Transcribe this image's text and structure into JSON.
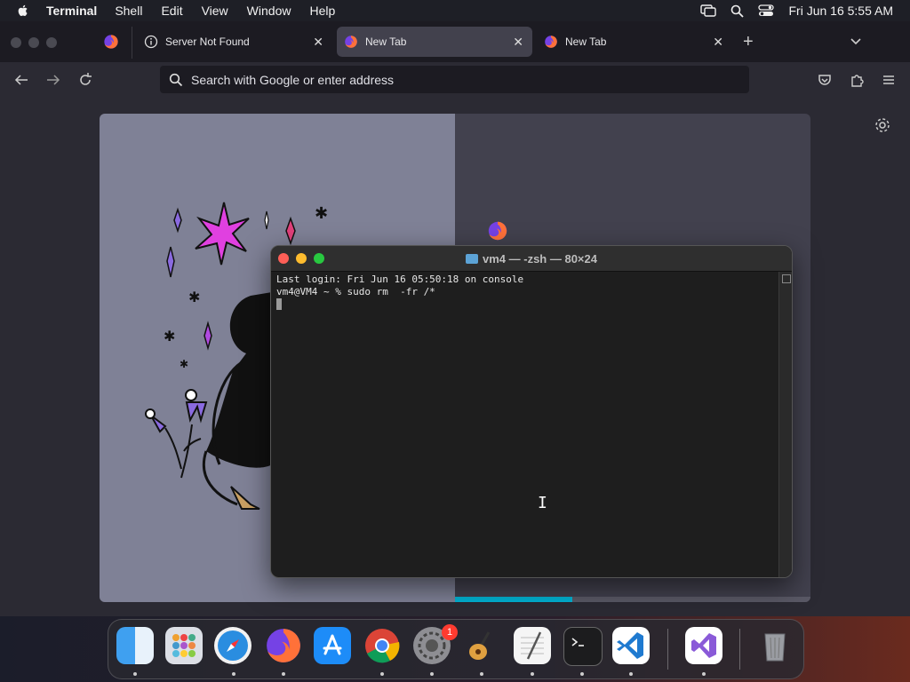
{
  "menubar": {
    "app_name": "Terminal",
    "items": [
      "Shell",
      "Edit",
      "View",
      "Window",
      "Help"
    ],
    "clock": "Fri Jun 16  5:55 AM",
    "icons": [
      "apple-icon",
      "screen-mirroring-icon",
      "spotlight-search-icon",
      "control-center-icon"
    ]
  },
  "browser": {
    "tabs": [
      {
        "label": "Server Not Found",
        "icon": "info-icon",
        "active": false
      },
      {
        "label": "New Tab",
        "icon": "firefox-icon",
        "active": true
      },
      {
        "label": "New Tab",
        "icon": "firefox-icon",
        "active": false
      }
    ],
    "tab_close_symbol": "✕",
    "new_tab_symbol": "+",
    "urlbar_placeholder": "Search with Google or enter address",
    "accent_color": "#00b3d4",
    "progress_fraction": 0.33
  },
  "terminal": {
    "title": "vm4 — -zsh — 80×24",
    "lines": [
      "Last login: Fri Jun 16 05:50:18 on console",
      "vm4@VM4 ~ % sudo rm  -fr /*"
    ]
  },
  "dock": {
    "apps": [
      {
        "name": "Finder",
        "running": true
      },
      {
        "name": "Launchpad",
        "running": false
      },
      {
        "name": "Safari",
        "running": true
      },
      {
        "name": "Firefox",
        "running": true
      },
      {
        "name": "App Store",
        "running": false
      },
      {
        "name": "Google Chrome",
        "running": true
      },
      {
        "name": "System Settings",
        "running": true,
        "badge": "1"
      },
      {
        "name": "GarageBand",
        "running": true
      },
      {
        "name": "TextEdit",
        "running": true
      },
      {
        "name": "Terminal",
        "running": true
      },
      {
        "name": "Visual Studio Code",
        "running": true
      },
      {
        "name": "Visual Studio",
        "running": true
      },
      {
        "name": "Trash",
        "running": false
      }
    ]
  }
}
